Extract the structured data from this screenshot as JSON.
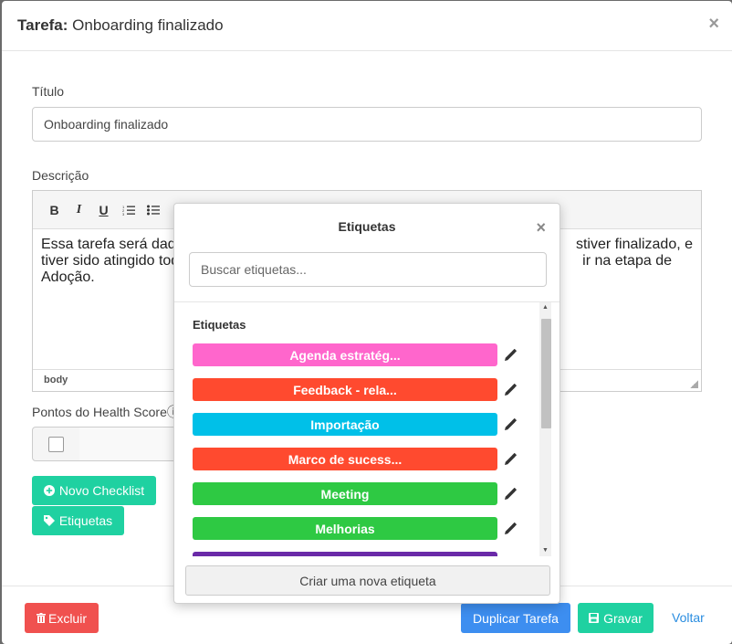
{
  "modal": {
    "title_prefix": "Tarefa:",
    "title_text": "Onboarding finalizado",
    "close_glyph": "×"
  },
  "form": {
    "title_label": "Título",
    "title_value": "Onboarding finalizado",
    "description_label": "Descrição",
    "description_lines": [
      "Essa tarefa será dad",
      "stiver finalizado, e",
      "tiver sido atingido tod",
      "ir na etapa de",
      "Adoção."
    ],
    "editor_status": "body",
    "toolbar": {
      "bold": "B",
      "italic": "I",
      "underline": "U"
    },
    "health_score_label": "Pontos do Health Scoreⓘ"
  },
  "buttons": {
    "new_checklist": "Novo Checklist",
    "tags": "Etiquetas",
    "delete": "Excluir",
    "duplicate": "Duplicar Tarefa",
    "save": "Gravar",
    "back": "Voltar"
  },
  "tags_popover": {
    "title": "Etiquetas",
    "close_glyph": "×",
    "search_placeholder": "Buscar etiquetas...",
    "section_title": "Etiquetas",
    "create_button": "Criar uma nova etiqueta",
    "tags": [
      {
        "label": "Agenda estratég...",
        "color": "#ff66cc"
      },
      {
        "label": "Feedback - rela...",
        "color": "#ff4a2f"
      },
      {
        "label": "Importação",
        "color": "#00c0e8"
      },
      {
        "label": "Marco de sucess...",
        "color": "#ff4a2f"
      },
      {
        "label": "Meeting",
        "color": "#2ec943"
      },
      {
        "label": "Melhorias",
        "color": "#2ec943"
      },
      {
        "label": "",
        "color": "#6a2aa8"
      }
    ]
  },
  "colors": {
    "primary_green": "#1fd1a1",
    "danger": "#f0514f",
    "blue": "#3d8ef0"
  }
}
